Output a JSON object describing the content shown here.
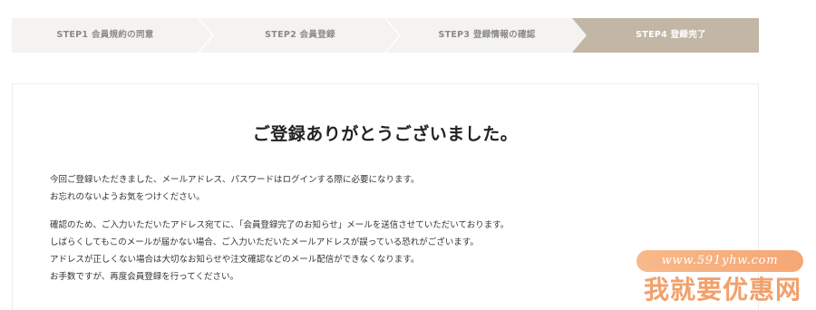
{
  "steps": [
    {
      "label": "STEP1 会員規約の同意",
      "state": "done"
    },
    {
      "label": "STEP2 会員登録",
      "state": "done"
    },
    {
      "label": "STEP3 登録情報の確認",
      "state": "done"
    },
    {
      "label": "STEP4 登録完了",
      "state": "active"
    }
  ],
  "colors": {
    "step_bg": "#f4f3f1",
    "step_active_bg": "#c2b6a4",
    "watermark": "#f2a06c"
  },
  "content": {
    "title": "ご登録ありがとうございました。",
    "paragraph1": [
      "今回ご登録いただきました、メールアドレス、パスワードはログインする際に必要になります。",
      "お忘れのないようお気をつけください。"
    ],
    "paragraph2": [
      "確認のため、ご入力いただいたアドレス宛てに、「会員登録完了のお知らせ」メールを送信させていただいております。",
      "しばらくしてもこのメールが届かない場合、ご入力いただいたメールアドレスが誤っている恐れがございます。",
      "アドレスが正しくない場合は大切なお知らせや注文確認などのメール配信ができなくなります。",
      "お手数ですが、再度会員登録を行ってください。"
    ]
  },
  "watermark": {
    "url": "www.591yhw.com",
    "text": "我就要优惠网"
  }
}
